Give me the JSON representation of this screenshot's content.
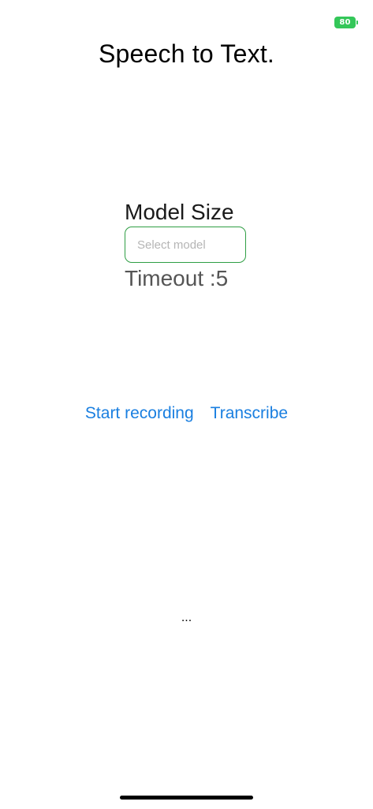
{
  "status_bar": {
    "battery_level": "80",
    "battery_color": "#34c759"
  },
  "header": {
    "title": "Speech to Text."
  },
  "form": {
    "model_size_label": "Model Size",
    "model_select_placeholder": "Select model",
    "timeout_label": "Timeout :5"
  },
  "actions": {
    "start_recording_label": "Start recording",
    "transcribe_label": "Transcribe",
    "link_color": "#1a7fe0"
  },
  "output": {
    "transcript_text": "..."
  }
}
